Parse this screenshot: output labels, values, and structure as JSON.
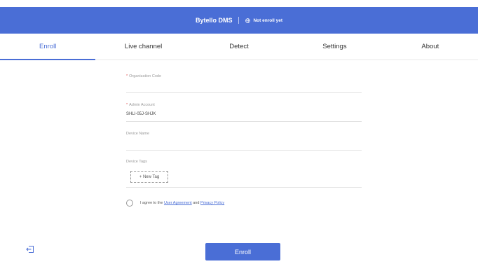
{
  "header": {
    "app_title": "Bytello DMS",
    "status_text": "Not enroll yet"
  },
  "tabs": [
    {
      "label": "Enroll",
      "active": true
    },
    {
      "label": "Live channel"
    },
    {
      "label": "Detect"
    },
    {
      "label": "Settings"
    },
    {
      "label": "About"
    }
  ],
  "form": {
    "required_mark": "*",
    "organization_code": {
      "label": "Organization Code",
      "value": ""
    },
    "admin_account": {
      "label": "Admin Account",
      "value": "SHLI-05J-SHJK"
    },
    "device_name": {
      "label": "Device Name",
      "value": ""
    },
    "device_tags": {
      "label": "Device Tags",
      "new_tag_label": "+ New Tag"
    }
  },
  "agreement": {
    "prefix": "I agree to the",
    "user_agreement": "User Agreement",
    "and": "and",
    "privacy_policy": "Privacy Policy"
  },
  "actions": {
    "enroll_button": "Enroll"
  },
  "icons": {
    "status_icon": "globe-icon",
    "logout_icon": "logout-icon"
  },
  "colors": {
    "accent": "#4a6ed6",
    "required": "#e24a4a"
  }
}
